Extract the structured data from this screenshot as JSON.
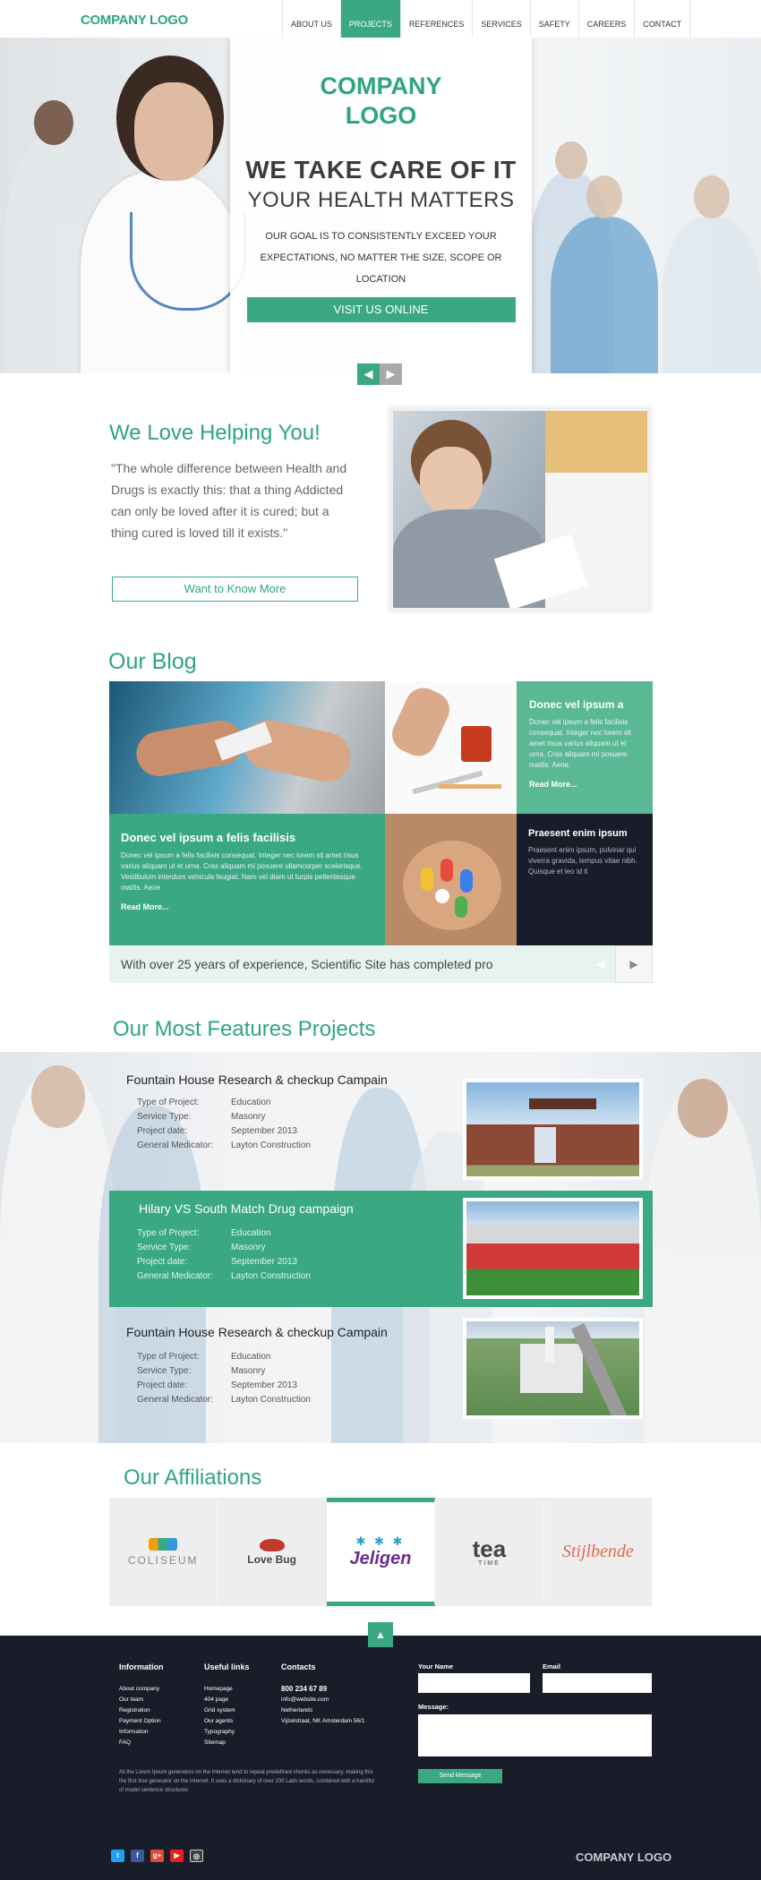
{
  "header": {
    "logo": "COMPANY LOGO",
    "nav": [
      "ABOUT US",
      "PROJECTS",
      "REFERENCES",
      "SERVICES",
      "SAFETY",
      "CAREERS",
      "CONTACT"
    ],
    "active": "PROJECTS"
  },
  "hero": {
    "logo_line1": "COMPANY",
    "logo_line2": "LOGO",
    "headline": "WE TAKE CARE OF IT",
    "subheadline": "YOUR HEALTH MATTERS",
    "subtext_line1": "OUR GOAL IS TO CONSISTENTLY EXCEED YOUR",
    "subtext_line2": "EXPECTATIONS, NO MATTER THE SIZE, SCOPE OR LOCATION",
    "button": "VISIT US ONLINE",
    "arrow_prev": "◀",
    "arrow_next": "▶"
  },
  "love": {
    "title": "We Love Helping You!",
    "quote": "\"The whole difference between Health  and Drugs is exactly this: that a thing Addicted can only be loved after it is cured; but a thing cured is loved till it exists.\"",
    "button": "Want to Know More"
  },
  "blog": {
    "title": "Our Blog",
    "card_top": {
      "title": "Donec vel ipsum a",
      "text": "Donec vel ipsum a felis facilisis consequat. Integer nec lorem sit amet risus varius aliquam ut et urna. Cras aliquam mi posuere mattis. Aene.",
      "read_more": "Read More..."
    },
    "card_main": {
      "title": "Donec vel ipsum a felis facilisis",
      "text": "Donec vel ipsum a felis facilisis consequat. Integer nec lorem sit amet risus varius aliquam ut et urna. Cras aliquam mi posuere ullamcorper scelerisque. Vestibulum interdum vehicula feugiat. Nam vel diam ut turpis pellentesque mattis. Aene",
      "read_more": "Read More..."
    },
    "card_dark": {
      "title": "Praesent enim ipsum",
      "text": "Praesent enim ipsum, pulvinar qui viverra gravida, tempus vitae nibh. Quisque et leo id it"
    },
    "ticker": "With over 25 years of experience, Scientific Site has completed pro",
    "ticker_prev": "◀",
    "ticker_next": "▶"
  },
  "projects": {
    "title": "Our Most Features Projects",
    "labels": [
      "Type of Project:",
      "Service Type:",
      "Project date:",
      "General Medicator:"
    ],
    "items": [
      {
        "name": "Fountain House Research & checkup Campain",
        "values": [
          "Education",
          "Masonry",
          "September 2013",
          "Layton Construction"
        ]
      },
      {
        "name": "Hilary VS South Match Drug campaign",
        "values": [
          "Education",
          "Masonry",
          "September 2013",
          "Layton Construction"
        ]
      },
      {
        "name": "Fountain House Research & checkup Campain",
        "values": [
          "Education",
          "Masonry",
          "September 2013",
          "Layton Construction"
        ]
      }
    ]
  },
  "affiliations": {
    "title": "Our Affiliations",
    "logos": [
      "COLISEUM",
      "Love Bug",
      "Jeligen",
      "tea",
      "Stijlbende"
    ],
    "tea_sub": "TIME"
  },
  "footer": {
    "top_arrow": "▲",
    "info_title": "Information",
    "info_links": [
      "About company",
      "Our team",
      "Registration",
      "Payment Option",
      "Information",
      "FAQ"
    ],
    "useful_title": "Useful links",
    "useful_links": [
      "Homepage",
      "404 page",
      "Grid system",
      "Our agents",
      "Typography",
      "Sitemap"
    ],
    "contacts_title": "Contacts",
    "phone": "800 234 67 89",
    "email_addr": "info@website.com",
    "country": "Netherlands",
    "address": "Vijzelstraat, NK Amsterdam 56/1",
    "note": "All the Lorem Ipsum generators on the Internet tend to repeat predefined chunks as necessary, making this the first true generator on the Internet. It uses a dictionary of over 200 Latin words, combined with a handful of model sentence structures",
    "name_label": "Your Name",
    "email_label": "Email",
    "message_label": "Message:",
    "send": "Send Message",
    "logo": "COMPANY LOGO",
    "social": [
      "twitter",
      "facebook",
      "google-plus",
      "youtube",
      "instagram"
    ]
  },
  "colors": {
    "accent": "#3aa981",
    "dark": "#191d29"
  }
}
